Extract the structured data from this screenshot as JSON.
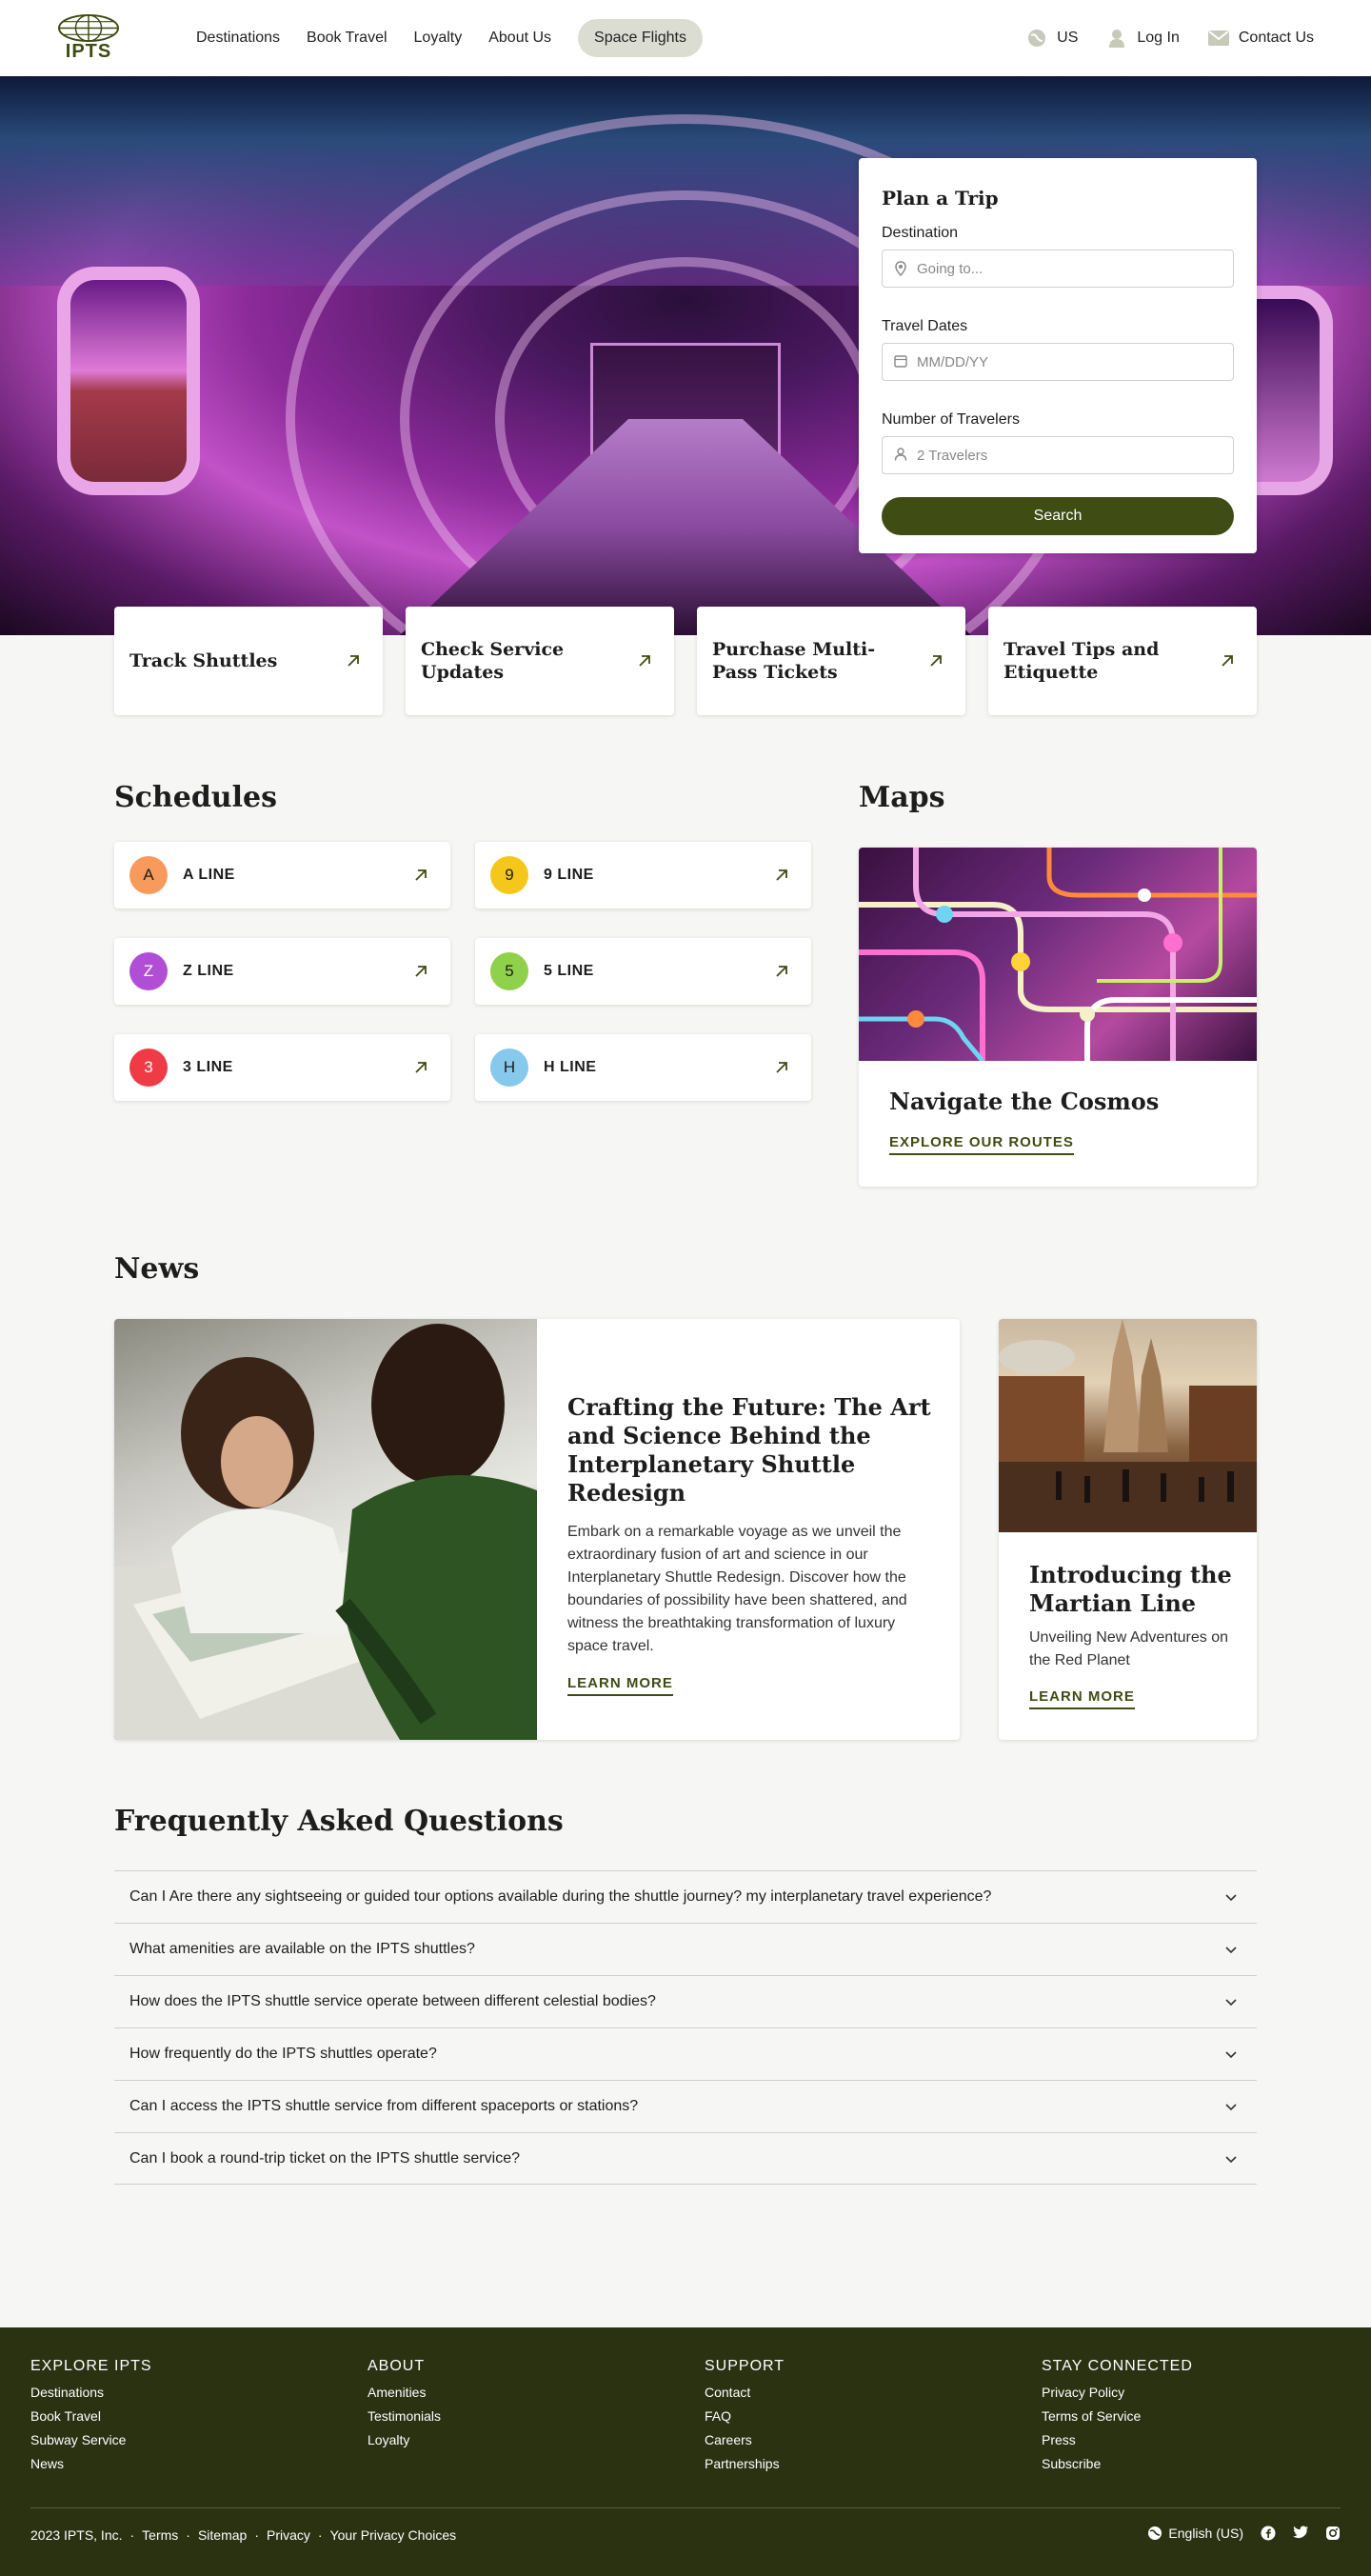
{
  "header": {
    "logo_text": "IPTS",
    "nav": [
      "Destinations",
      "Book Travel",
      "Loyalty",
      "About Us"
    ],
    "nav_pill": "Space Flights",
    "region": "US",
    "login": "Log In",
    "contact": "Contact Us"
  },
  "plan": {
    "title": "Plan a Trip",
    "destination_label": "Destination",
    "destination_placeholder": "Going to...",
    "dates_label": "Travel Dates",
    "dates_placeholder": "MM/DD/YY",
    "travelers_label": "Number of Travelers",
    "travelers_value": "2 Travelers",
    "search_label": "Search"
  },
  "quick_links": [
    "Track Shuttles",
    "Check Service Updates",
    "Purchase Multi-Pass Tickets",
    "Travel Tips and Etiquette"
  ],
  "schedules": {
    "title": "Schedules",
    "lines": [
      {
        "badge": "A",
        "name": "A LINE",
        "color": "#f79a5b",
        "text_color": "#1d1d1d"
      },
      {
        "badge": "9",
        "name": "9 LINE",
        "color": "#f5c71a",
        "text_color": "#1d1d1d"
      },
      {
        "badge": "Z",
        "name": "Z LINE",
        "color": "#b04fd6",
        "text_color": "#ffffff"
      },
      {
        "badge": "5",
        "name": "5 LINE",
        "color": "#8fd14a",
        "text_color": "#1d1d1d"
      },
      {
        "badge": "3",
        "name": "3 LINE",
        "color": "#ef3b45",
        "text_color": "#ffffff"
      },
      {
        "badge": "H",
        "name": "H LINE",
        "color": "#86c9ec",
        "text_color": "#1d1d1d"
      }
    ]
  },
  "maps": {
    "title": "Maps",
    "card_title": "Navigate the Cosmos",
    "link": "EXPLORE OUR ROUTES"
  },
  "news": {
    "title": "News",
    "main": {
      "title": "Crafting the Future: The Art and Science Behind the Interplanetary Shuttle Redesign",
      "body": "Embark on a remarkable voyage as we unveil the extraordinary fusion of art and science in our Interplanetary Shuttle Redesign. Discover how the boundaries of possibility have been shattered, and witness the breathtaking transformation of luxury space travel.",
      "link": "LEARN MORE"
    },
    "side": {
      "title": "Introducing the Martian Line",
      "body": "Unveiling New Adventures on the Red Planet",
      "link": "LEARN MORE"
    }
  },
  "faq": {
    "title": "Frequently Asked Questions",
    "items": [
      "Can I Are there any sightseeing or guided tour options available during the shuttle journey? my interplanetary travel experience?",
      "What amenities are available on the IPTS shuttles?",
      "How does the IPTS shuttle service operate between different celestial bodies?",
      "How frequently do the IPTS shuttles operate?",
      "Can I access the IPTS shuttle service from different spaceports or stations?",
      "Can I book a round-trip ticket on the IPTS shuttle service?"
    ]
  },
  "footer": {
    "columns": [
      {
        "title": "EXPLORE IPTS",
        "links": [
          "Destinations",
          "Book Travel",
          "Subway Service",
          "News"
        ]
      },
      {
        "title": "ABOUT",
        "links": [
          "Amenities",
          "Testimonials",
          "Loyalty"
        ]
      },
      {
        "title": "SUPPORT",
        "links": [
          "Contact",
          "FAQ",
          "Careers",
          "Partnerships"
        ]
      },
      {
        "title": "STAY CONNECTED",
        "links": [
          "Privacy Policy",
          "Terms of Service",
          "Press",
          "Subscribe"
        ]
      }
    ],
    "copyright": "2023 IPTS, Inc.",
    "legal": [
      "Terms",
      "Sitemap",
      "Privacy",
      "Your Privacy Choices"
    ],
    "language": "English (US)",
    "social": [
      "facebook-icon",
      "twitter-icon",
      "instagram-icon"
    ]
  }
}
